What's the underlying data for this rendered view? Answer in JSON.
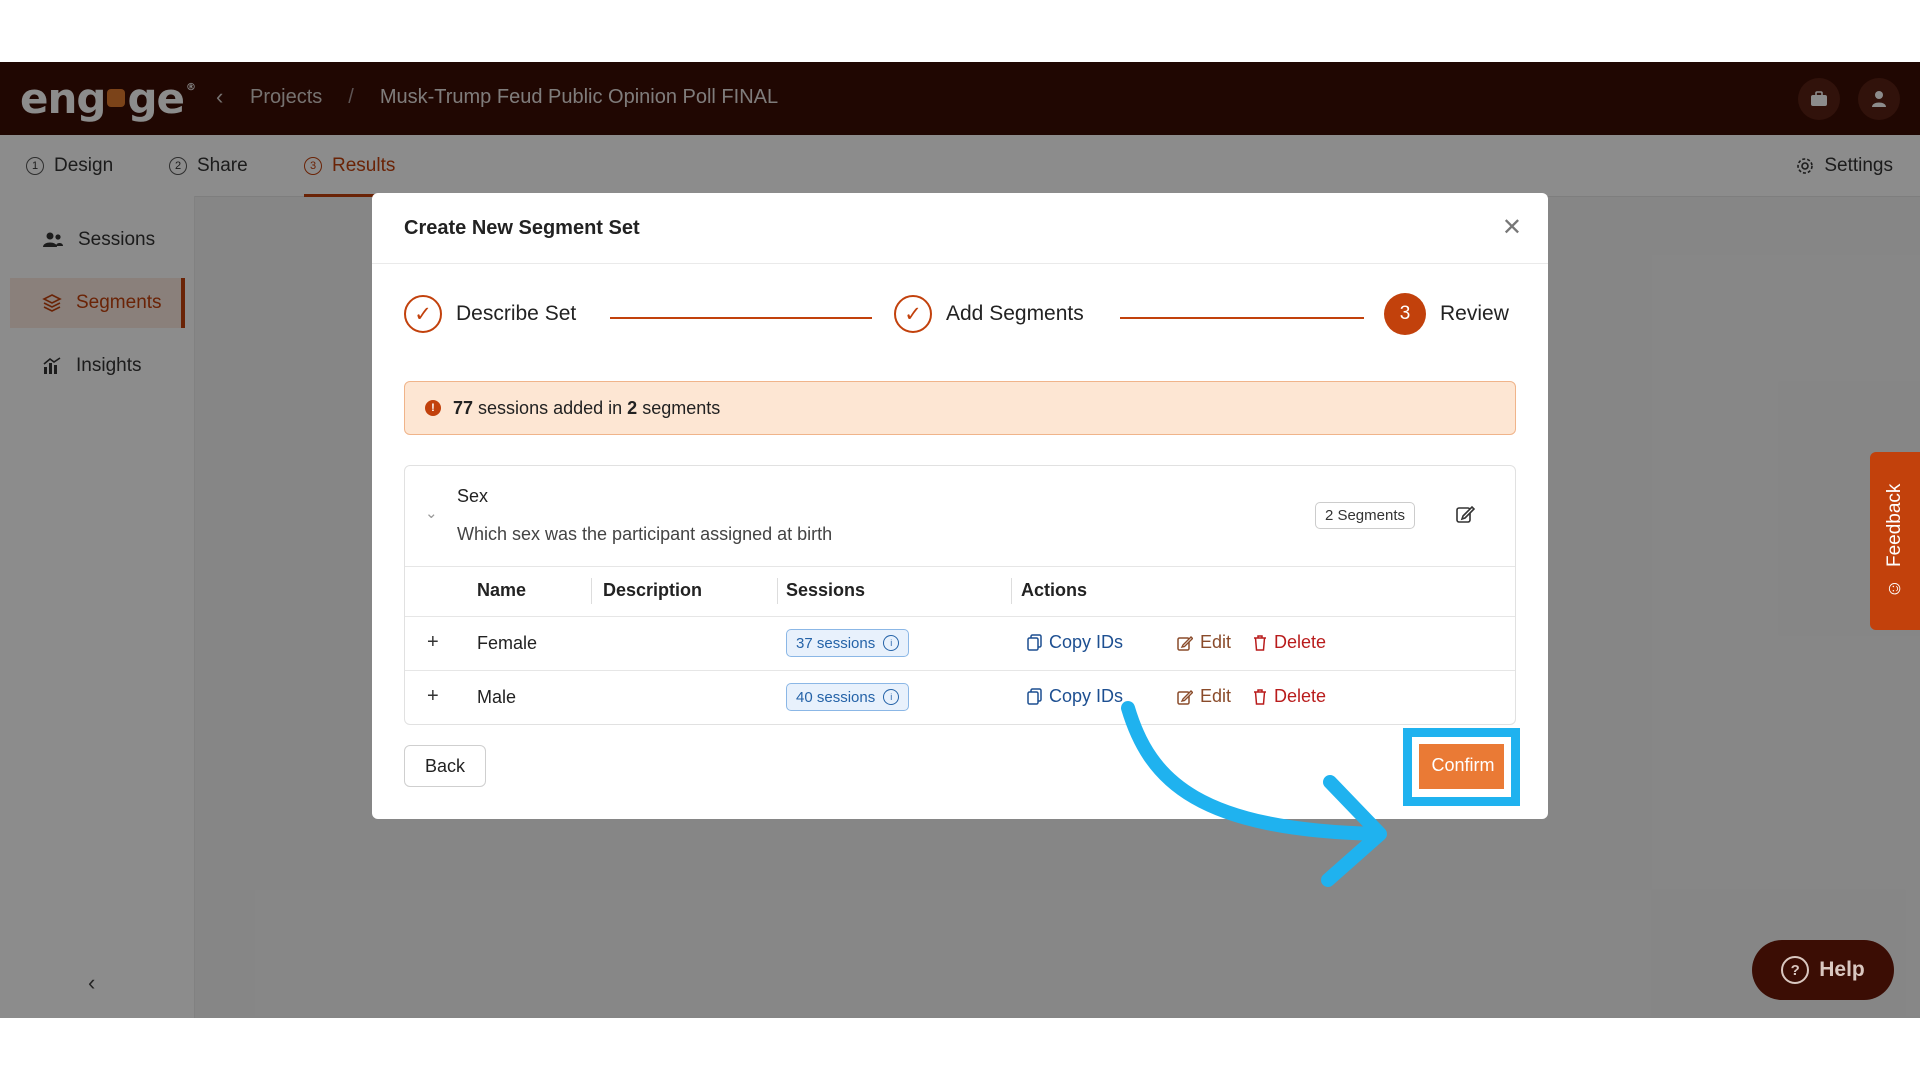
{
  "app": {
    "logo_text": "engage",
    "breadcrumb": {
      "projects": "Projects",
      "separator": "/",
      "project_name": "Musk-Trump Feud Public Opinion Poll FINAL"
    }
  },
  "tabs": [
    {
      "num": "1",
      "label": "Design"
    },
    {
      "num": "2",
      "label": "Share"
    },
    {
      "num": "3",
      "label": "Results",
      "active": true
    }
  ],
  "settings_label": "Settings",
  "sidebar": {
    "items": [
      {
        "label": "Sessions",
        "icon": "users-icon"
      },
      {
        "label": "Segments",
        "icon": "layers-icon",
        "active": true
      },
      {
        "label": "Insights",
        "icon": "chart-icon"
      }
    ]
  },
  "modal": {
    "title": "Create New Segment Set",
    "steps": [
      {
        "label": "Describe Set",
        "state": "done"
      },
      {
        "label": "Add Segments",
        "state": "done"
      },
      {
        "label": "Review",
        "num": "3",
        "state": "current"
      }
    ],
    "alert": {
      "count_sessions": "77",
      "text_mid": "sessions added in",
      "count_segments": "2",
      "text_end": "segments"
    },
    "segment": {
      "name": "Sex",
      "description": "Which sex was the participant assigned at birth",
      "badge": "2 Segments",
      "columns": [
        "Name",
        "Description",
        "Sessions",
        "Actions"
      ],
      "rows": [
        {
          "name": "Female",
          "description": "",
          "sessions": "37 sessions"
        },
        {
          "name": "Male",
          "description": "",
          "sessions": "40 sessions"
        }
      ],
      "actions": {
        "copy": "Copy IDs",
        "edit": "Edit",
        "delete": "Delete"
      }
    },
    "back_label": "Back",
    "confirm_label": "Confirm"
  },
  "feedback_label": "Feedback",
  "help_label": "Help",
  "colors": {
    "brand_dark": "#3b0d04",
    "accent": "#c2410c",
    "confirm": "#ea7a35",
    "highlight": "#1fb2ef"
  }
}
